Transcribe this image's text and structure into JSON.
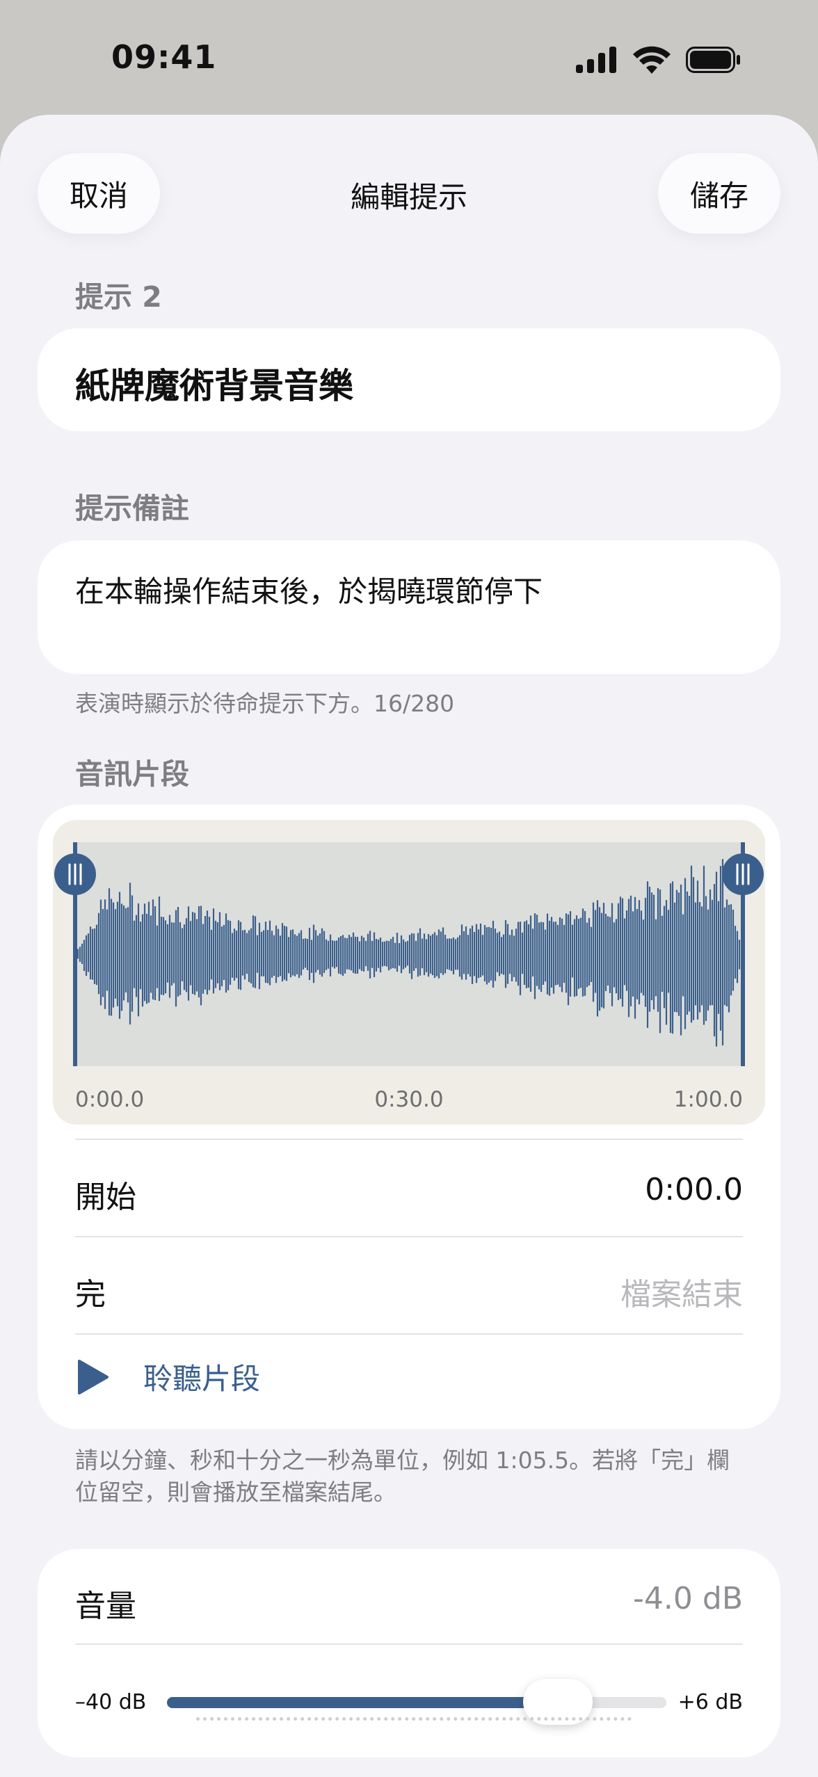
{
  "status_bar": {
    "time": "09:41"
  },
  "nav": {
    "cancel_label": "取消",
    "title": "編輯提示",
    "save_label": "儲存"
  },
  "cue": {
    "section_label": "提示 2",
    "name": "紙牌魔術背景音樂"
  },
  "note": {
    "section_label": "提示備註",
    "value": "在本輪操作結束後，於揭曉環節停下",
    "helper": "表演時顯示於待命提示下方。16/280"
  },
  "audio": {
    "section_label": "音訊片段",
    "timeline": {
      "start": "0:00.0",
      "mid": "0:30.0",
      "end": "1:00.0"
    },
    "start_label": "開始",
    "start_value": "0:00.0",
    "end_label": "完",
    "end_placeholder": "檔案結束",
    "preview_label": "聆聽片段",
    "helper": "請以分鐘、秒和十分之一秒為單位，例如 1:05.5。若將「完」欄位留空，則會播放至檔案結尾。"
  },
  "volume": {
    "label": "音量",
    "value": "-4.0 dB",
    "min_label": "–40 dB",
    "max_label": "+6 dB",
    "level_fraction": 0.783
  },
  "colors": {
    "accent": "#3b5f8c",
    "background": "#f2f2f7",
    "card": "#ffffff",
    "waveform": "#3b5f8c"
  },
  "icons": [
    "signal-icon",
    "wifi-icon",
    "battery-icon",
    "play-icon",
    "trim-handle-icon"
  ]
}
